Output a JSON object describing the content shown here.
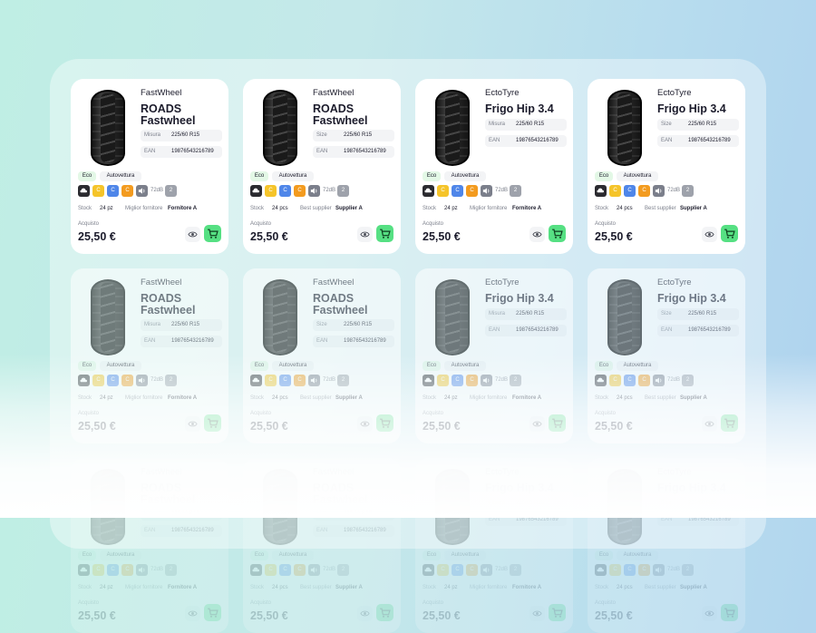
{
  "labels": {
    "stock": "Stock",
    "ean": "EAN",
    "purchase": "Acquisto"
  },
  "products": [
    {
      "brand": "FastWheel",
      "model": "ROADS Fastwheel",
      "size_label": "Misura",
      "size": "225/60 R15",
      "ean": "19876543216789",
      "badge_eco": "Eco",
      "badge_type": "Autovettura",
      "energy": [
        "C",
        "C",
        "C",
        "C"
      ],
      "noise": "72dB",
      "noise_class": "2",
      "stock": "24 pz",
      "supplier_label": "Miglior fornitore",
      "supplier": "Fornitore A",
      "price": "25,50 €"
    },
    {
      "brand": "FastWheel",
      "model": "ROADS Fastwheel",
      "size_label": "Size",
      "size": "225/60 R15",
      "ean": "19876543216789",
      "badge_eco": "Eco",
      "badge_type": "Autovettura",
      "energy": [
        "C",
        "C",
        "C",
        "C"
      ],
      "noise": "72dB",
      "noise_class": "2",
      "stock": "24 pcs",
      "supplier_label": "Best supplier",
      "supplier": "Supplier A",
      "price": "25,50 €"
    },
    {
      "brand": "EctoTyre",
      "model": "Frigo Hip 3.4",
      "size_label": "Misura",
      "size": "225/60 R15",
      "ean": "19876543216789",
      "badge_eco": "Eco",
      "badge_type": "Autovettura",
      "energy": [
        "C",
        "C",
        "C",
        "C"
      ],
      "noise": "72dB",
      "noise_class": "2",
      "stock": "24 pz",
      "supplier_label": "Miglior fornitore",
      "supplier": "Fornitore A",
      "price": "25,50 €"
    },
    {
      "brand": "EctoTyre",
      "model": "Frigo Hip 3.4",
      "size_label": "Size",
      "size": "225/60 R15",
      "ean": "19876543216789",
      "badge_eco": "Eco",
      "badge_type": "Autovettura",
      "energy": [
        "C",
        "C",
        "C",
        "C"
      ],
      "noise": "72dB",
      "noise_class": "2",
      "stock": "24 pcs",
      "supplier_label": "Best supplier",
      "supplier": "Supplier A",
      "price": "25,50 €"
    }
  ],
  "colors": {
    "cart_button": "#56e083",
    "eco_badge": "#e3f8e6",
    "energy_dark": "#2b2b30",
    "energy_yellow": "#f5c42a",
    "energy_blue": "#4f86e9",
    "energy_orange": "#f39b1f"
  },
  "icons": [
    "tyre-image",
    "weather-icon",
    "fuel-icon",
    "rain-icon",
    "grip-icon",
    "speaker-icon",
    "eye-icon",
    "cart-icon"
  ]
}
